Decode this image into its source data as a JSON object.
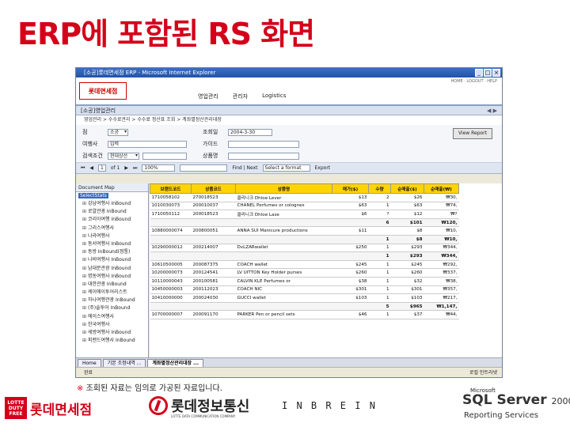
{
  "slide": {
    "title": "ERP에 포함된 RS 화면",
    "footnote_mark": "※",
    "footnote": "조회된 자료는 임의로 가공된 자료입니다."
  },
  "browser": {
    "title": "[소공]롯데면세점 ERP - Microsoft Internet Explorer",
    "status_left": "완료",
    "status_right": "로컬 인트라넷"
  },
  "app": {
    "logo": "롯데면세점",
    "top_links": "HOME · LOGOUT · HELP",
    "menu": [
      "영업관리",
      "관리자",
      "Logistics"
    ],
    "submenu": "[소공]영업관리",
    "submenu_right": "◀ ▶",
    "breadcrumb": "영업관리 > 수수료관리 > 수수료 정산표 조회 > 계좌별정산관리대장"
  },
  "form": {
    "store_label": "점",
    "store_value": "소공",
    "agency_label": "여행사",
    "agency_value": "입력",
    "search_label": "검색조건",
    "search_value": "현대상선",
    "date_label": "조회일",
    "date_value": "2004-3-30",
    "guide_label": "가이드",
    "product_label": "상품명",
    "view_button": "View Report"
  },
  "toolbar": {
    "page": "1",
    "of": "of 1",
    "zoom": "100%",
    "find": "Find | Next",
    "format": "Select a format",
    "export": "Export"
  },
  "docmap": {
    "header": "Document Map",
    "root": "SelectStats",
    "items": [
      "강남여행사 InBound",
      "로얄관광 InBound",
      "코리아여행 InBound",
      "그리스여행사",
      "나라여행사",
      "동서여행사 InBound",
      "동방 InBound(정통)",
      "나비여행사 InBound",
      "남대문관광 InBound",
      "명동여행사 InBound",
      "대한관광 InBound",
      "케이에이투어리스트",
      "하나여행관광 InBound",
      "(주)솔투어 InBound",
      "에이스여행사",
      "한국여행사",
      "세방여행사 InBound",
      "피렌드여행사 InBound"
    ]
  },
  "report": {
    "headers": [
      "브랜드코드",
      "상품코드",
      "상품명",
      "매가($)",
      "수량",
      "순매출($)",
      "순매출(₩)"
    ],
    "rows": [
      {
        "brand": "1710058102",
        "code": "270018523",
        "name": "클리니크 Dhloe Lever",
        "price": "$13",
        "qty": "2",
        "net": "$26",
        "krw": "₩30,"
      },
      {
        "brand": "1010030073",
        "code": "200010037",
        "name": "CHANEL Perfumes or colognes",
        "price": "$63",
        "qty": "1",
        "net": "$63",
        "krw": "₩74,"
      },
      {
        "brand": "1710050112",
        "code": "200018523",
        "name": "클리니크 Dhloe Lase",
        "price": "$6",
        "qty": "?",
        "net": "$12",
        "krw": "₩?"
      },
      {
        "brand": "",
        "code": "",
        "name": "",
        "price": "",
        "qty": "6",
        "net": "$101",
        "krw": "₩120,",
        "sub": true
      },
      {
        "brand": "10880000074",
        "code": "200800051",
        "name": "ANNA SUI Manicure productions",
        "price": "$11",
        "qty": "",
        "net": "$8",
        "krw": "₩10,"
      },
      {
        "brand": "",
        "code": "",
        "name": "",
        "price": "",
        "qty": "1",
        "net": "$8",
        "krw": "₩10,",
        "sub": true
      },
      {
        "brand": "10290000012",
        "code": "200214007",
        "name": "DvLZARwallet",
        "price": "$250",
        "qty": "1",
        "net": "$293",
        "krw": "₩344,"
      },
      {
        "brand": "",
        "code": "",
        "name": "",
        "price": "",
        "qty": "1",
        "net": "$293",
        "krw": "₩344,",
        "sub": true
      },
      {
        "brand": "10610500005",
        "code": "200087375",
        "name": "COACH wallet",
        "price": "$245",
        "qty": "1",
        "net": "$245",
        "krw": "₩292,"
      },
      {
        "brand": "10200000073",
        "code": "200124541",
        "name": "LV UITTON Key Holder purses",
        "price": "$260",
        "qty": "1",
        "net": "$260",
        "krw": "₩337,"
      },
      {
        "brand": "10110000043",
        "code": "200100581",
        "name": "CALVIN KLE Perfumes or",
        "price": "$38",
        "qty": "1",
        "net": "$32",
        "krw": "₩38,"
      },
      {
        "brand": "10450000003",
        "code": "200112023",
        "name": "COACH NIC",
        "price": "$301",
        "qty": "1",
        "net": "$301",
        "krw": "₩357,"
      },
      {
        "brand": "10410000000",
        "code": "200024030",
        "name": "GUCCI wallet",
        "price": "$103",
        "qty": "1",
        "net": "$103",
        "krw": "₩217,"
      },
      {
        "brand": "",
        "code": "",
        "name": "",
        "price": "",
        "qty": "5",
        "net": "$965",
        "krw": "₩1,147,",
        "sub": true
      },
      {
        "brand": "10700000007",
        "code": "200091170",
        "name": "PARKER Pen or pencil sets",
        "price": "$46",
        "qty": "1",
        "net": "$37",
        "krw": "₩44,"
      }
    ]
  },
  "tabs": [
    "Home",
    "기본 조정내역 ...",
    "계좌별정산관리대장 ..."
  ],
  "logos": {
    "duty_free_badge": "LOTTE DUTY FREE",
    "duty_free": "롯데면세점",
    "datacom": "롯데정보통신",
    "datacom_sub": "LOTTE DATA COMMUNICATION COMPANY",
    "inbre": "I N B R E I N",
    "ms": "Microsoft",
    "sql": "SQL Server",
    "year": "2000",
    "rs": "Reporting Services"
  },
  "colors": {
    "title_red": "#d4001a",
    "header_yellow": "#ffd400",
    "titlebar_blue": "#2253a8"
  }
}
